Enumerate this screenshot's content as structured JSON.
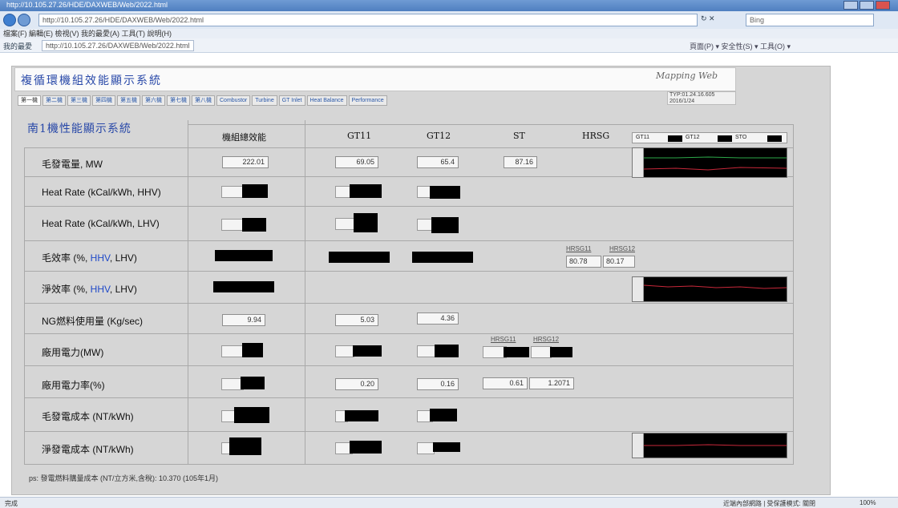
{
  "browser": {
    "address": "http://10.105.27.26/HDE/DAXWEB/Web/2022.html",
    "search_placeholder": "Bing",
    "menu": "檔案(F)  編輯(E)  檢視(V)  我的最愛(A)  工具(T)  說明(H)",
    "fav_label": "我的最愛",
    "tab_url": "http://10.105.27.26/DAXWEB/Web/2022.html",
    "toolbar_right": "頁面(P) ▾  安全性(S) ▾  工具(O) ▾",
    "status_left": "完成",
    "status_zone": "近端內部網路 | 受保護模式: 關閉",
    "zoom": "100%"
  },
  "header": {
    "system_title": "複循環機組效能顯示系統",
    "brand": "Mapping Web",
    "meta_line1": "TYP:01.24.16.605",
    "meta_line2": "2016/1/24"
  },
  "nav_tabs": [
    "第一機",
    "第二機",
    "第三機",
    "第四機",
    "第五機",
    "第六機",
    "第七機",
    "第八機",
    "Combustor",
    "Turbine",
    "GT Inlet",
    "Heat Balance",
    "Performance"
  ],
  "section_title": "南1機性能顯示系統",
  "columns": {
    "total": "機組總效能",
    "gt11": "GT11",
    "gt12": "GT12",
    "st": "ST",
    "hrsg": "HRSG"
  },
  "legend": {
    "gt11": "GT11",
    "gt12": "GT12",
    "st": "STO"
  },
  "rows": {
    "mw": {
      "label": "毛發電量, MW",
      "total": "222.01",
      "gt11": "69.05",
      "gt12": "65.4",
      "st": "87.16"
    },
    "hr_hhv": {
      "label": "Heat Rate (kCal/kWh, HHV)"
    },
    "hr_lhv": {
      "label": "Heat Rate (kCal/kWh, LHV)"
    },
    "gross_eff": {
      "label_a": "毛效率 (%, ",
      "label_hhv": "HHV",
      "label_b": ", LHV)",
      "hrsg1_label": "HRSG11",
      "hrsg2_label": "HRSG12",
      "hrsg1": "80.78",
      "hrsg2": "80.17"
    },
    "net_eff": {
      "label_a": "淨效率 (%, ",
      "label_hhv": "HHV",
      "label_b": ", LHV)"
    },
    "ng": {
      "label": "NG燃料使用量 (Kg/sec)",
      "total": "9.94",
      "gt11": "5.03",
      "gt12": "4.36"
    },
    "aux": {
      "label": "廠用電力(MW)",
      "hrsg1_label": "HRSG11",
      "hrsg2_label": "HRSG12"
    },
    "aux_rate": {
      "label": "廠用電力率(%)",
      "gt11": "0.20",
      "gt12": "0.16",
      "st": "0.61",
      "hrsg": "1.2071"
    },
    "gross_cost": {
      "label": "毛發電成本 (NT/kWh)"
    },
    "net_cost": {
      "label": "淨發電成本 (NT/kWh)"
    }
  },
  "footer_note": "ps: 發電燃料購量成本 (NT/立方米,含稅): 10.370 (105年1月)"
}
